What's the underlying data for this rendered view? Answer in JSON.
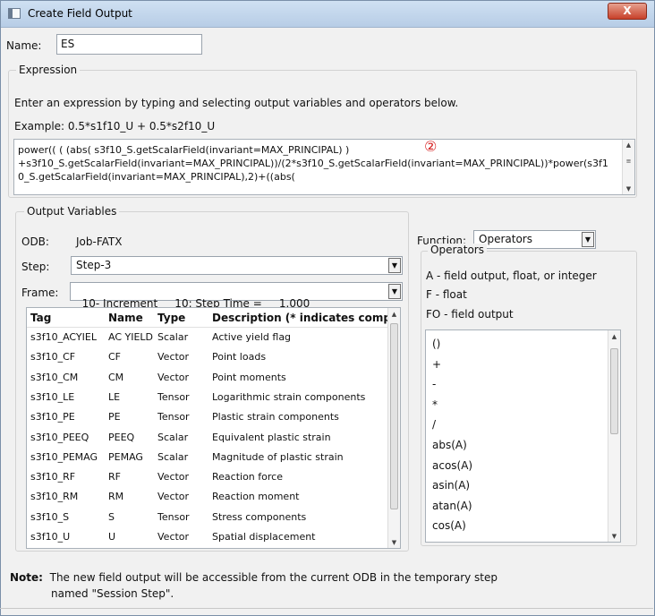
{
  "window": {
    "title": "Create Field Output",
    "close_label": "X"
  },
  "name": {
    "label": "Name:",
    "value": "ES"
  },
  "expression": {
    "legend": "Expression",
    "instruction": "Enter an expression by typing and selecting output variables and operators below.",
    "example": "Example: 0.5*s1f10_U + 0.5*s2f10_U",
    "text": "power(( ( (abs( s3f10_S.getScalarField(invariant=MAX_PRINCIPAL) ) \n+s3f10_S.getScalarField(invariant=MAX_PRINCIPAL))/(2*s3f10_S.getScalarField(invariant=MAX_PRINCIPAL))*power(s3f10_S.getScalarField(invariant=MAX_PRINCIPAL),2)+((abs(",
    "annotation": "②"
  },
  "output_variables": {
    "legend": "Output Variables",
    "odb_label": "ODB:",
    "odb_value": "Job-FATX",
    "step_label": "Step:",
    "step_value": "Step-3",
    "frame_label": "Frame:",
    "frame_value": "10- Increment     10: Step Time =     1.000",
    "columns": [
      "Tag",
      "Name",
      "Type",
      "Description (* indicates comp"
    ],
    "rows": [
      {
        "tag": "s3f10_ACYIEL",
        "name": "AC YIELD",
        "type": "Scalar",
        "desc": "Active yield flag"
      },
      {
        "tag": "s3f10_CF",
        "name": "CF",
        "type": "Vector",
        "desc": "Point loads"
      },
      {
        "tag": "s3f10_CM",
        "name": "CM",
        "type": "Vector",
        "desc": "Point moments"
      },
      {
        "tag": "s3f10_LE",
        "name": "LE",
        "type": "Tensor",
        "desc": "Logarithmic strain components"
      },
      {
        "tag": "s3f10_PE",
        "name": "PE",
        "type": "Tensor",
        "desc": "Plastic strain components"
      },
      {
        "tag": "s3f10_PEEQ",
        "name": "PEEQ",
        "type": "Scalar",
        "desc": "Equivalent plastic strain"
      },
      {
        "tag": "s3f10_PEMAG",
        "name": "PEMAG",
        "type": "Scalar",
        "desc": "Magnitude of plastic strain"
      },
      {
        "tag": "s3f10_RF",
        "name": "RF",
        "type": "Vector",
        "desc": "Reaction force"
      },
      {
        "tag": "s3f10_RM",
        "name": "RM",
        "type": "Vector",
        "desc": "Reaction moment"
      },
      {
        "tag": "s3f10_S",
        "name": "S",
        "type": "Tensor",
        "desc": "Stress components"
      },
      {
        "tag": "s3f10_U",
        "name": "U",
        "type": "Vector",
        "desc": "Spatial displacement"
      }
    ]
  },
  "function": {
    "label": "Function:",
    "value": "Operators"
  },
  "operators": {
    "legend": "Operators",
    "legend_a": "A -  field output, float, or integer",
    "legend_f": "F -  float",
    "legend_fo": "FO - field output",
    "items": [
      "()",
      "+",
      "-",
      "*",
      "/",
      "abs(A)",
      "acos(A)",
      "asin(A)",
      "atan(A)",
      "cos(A)"
    ]
  },
  "note": {
    "label": "Note:",
    "line1": "The new field output will be accessible from the current ODB in the temporary step",
    "line2": "named \"Session Step\"."
  }
}
